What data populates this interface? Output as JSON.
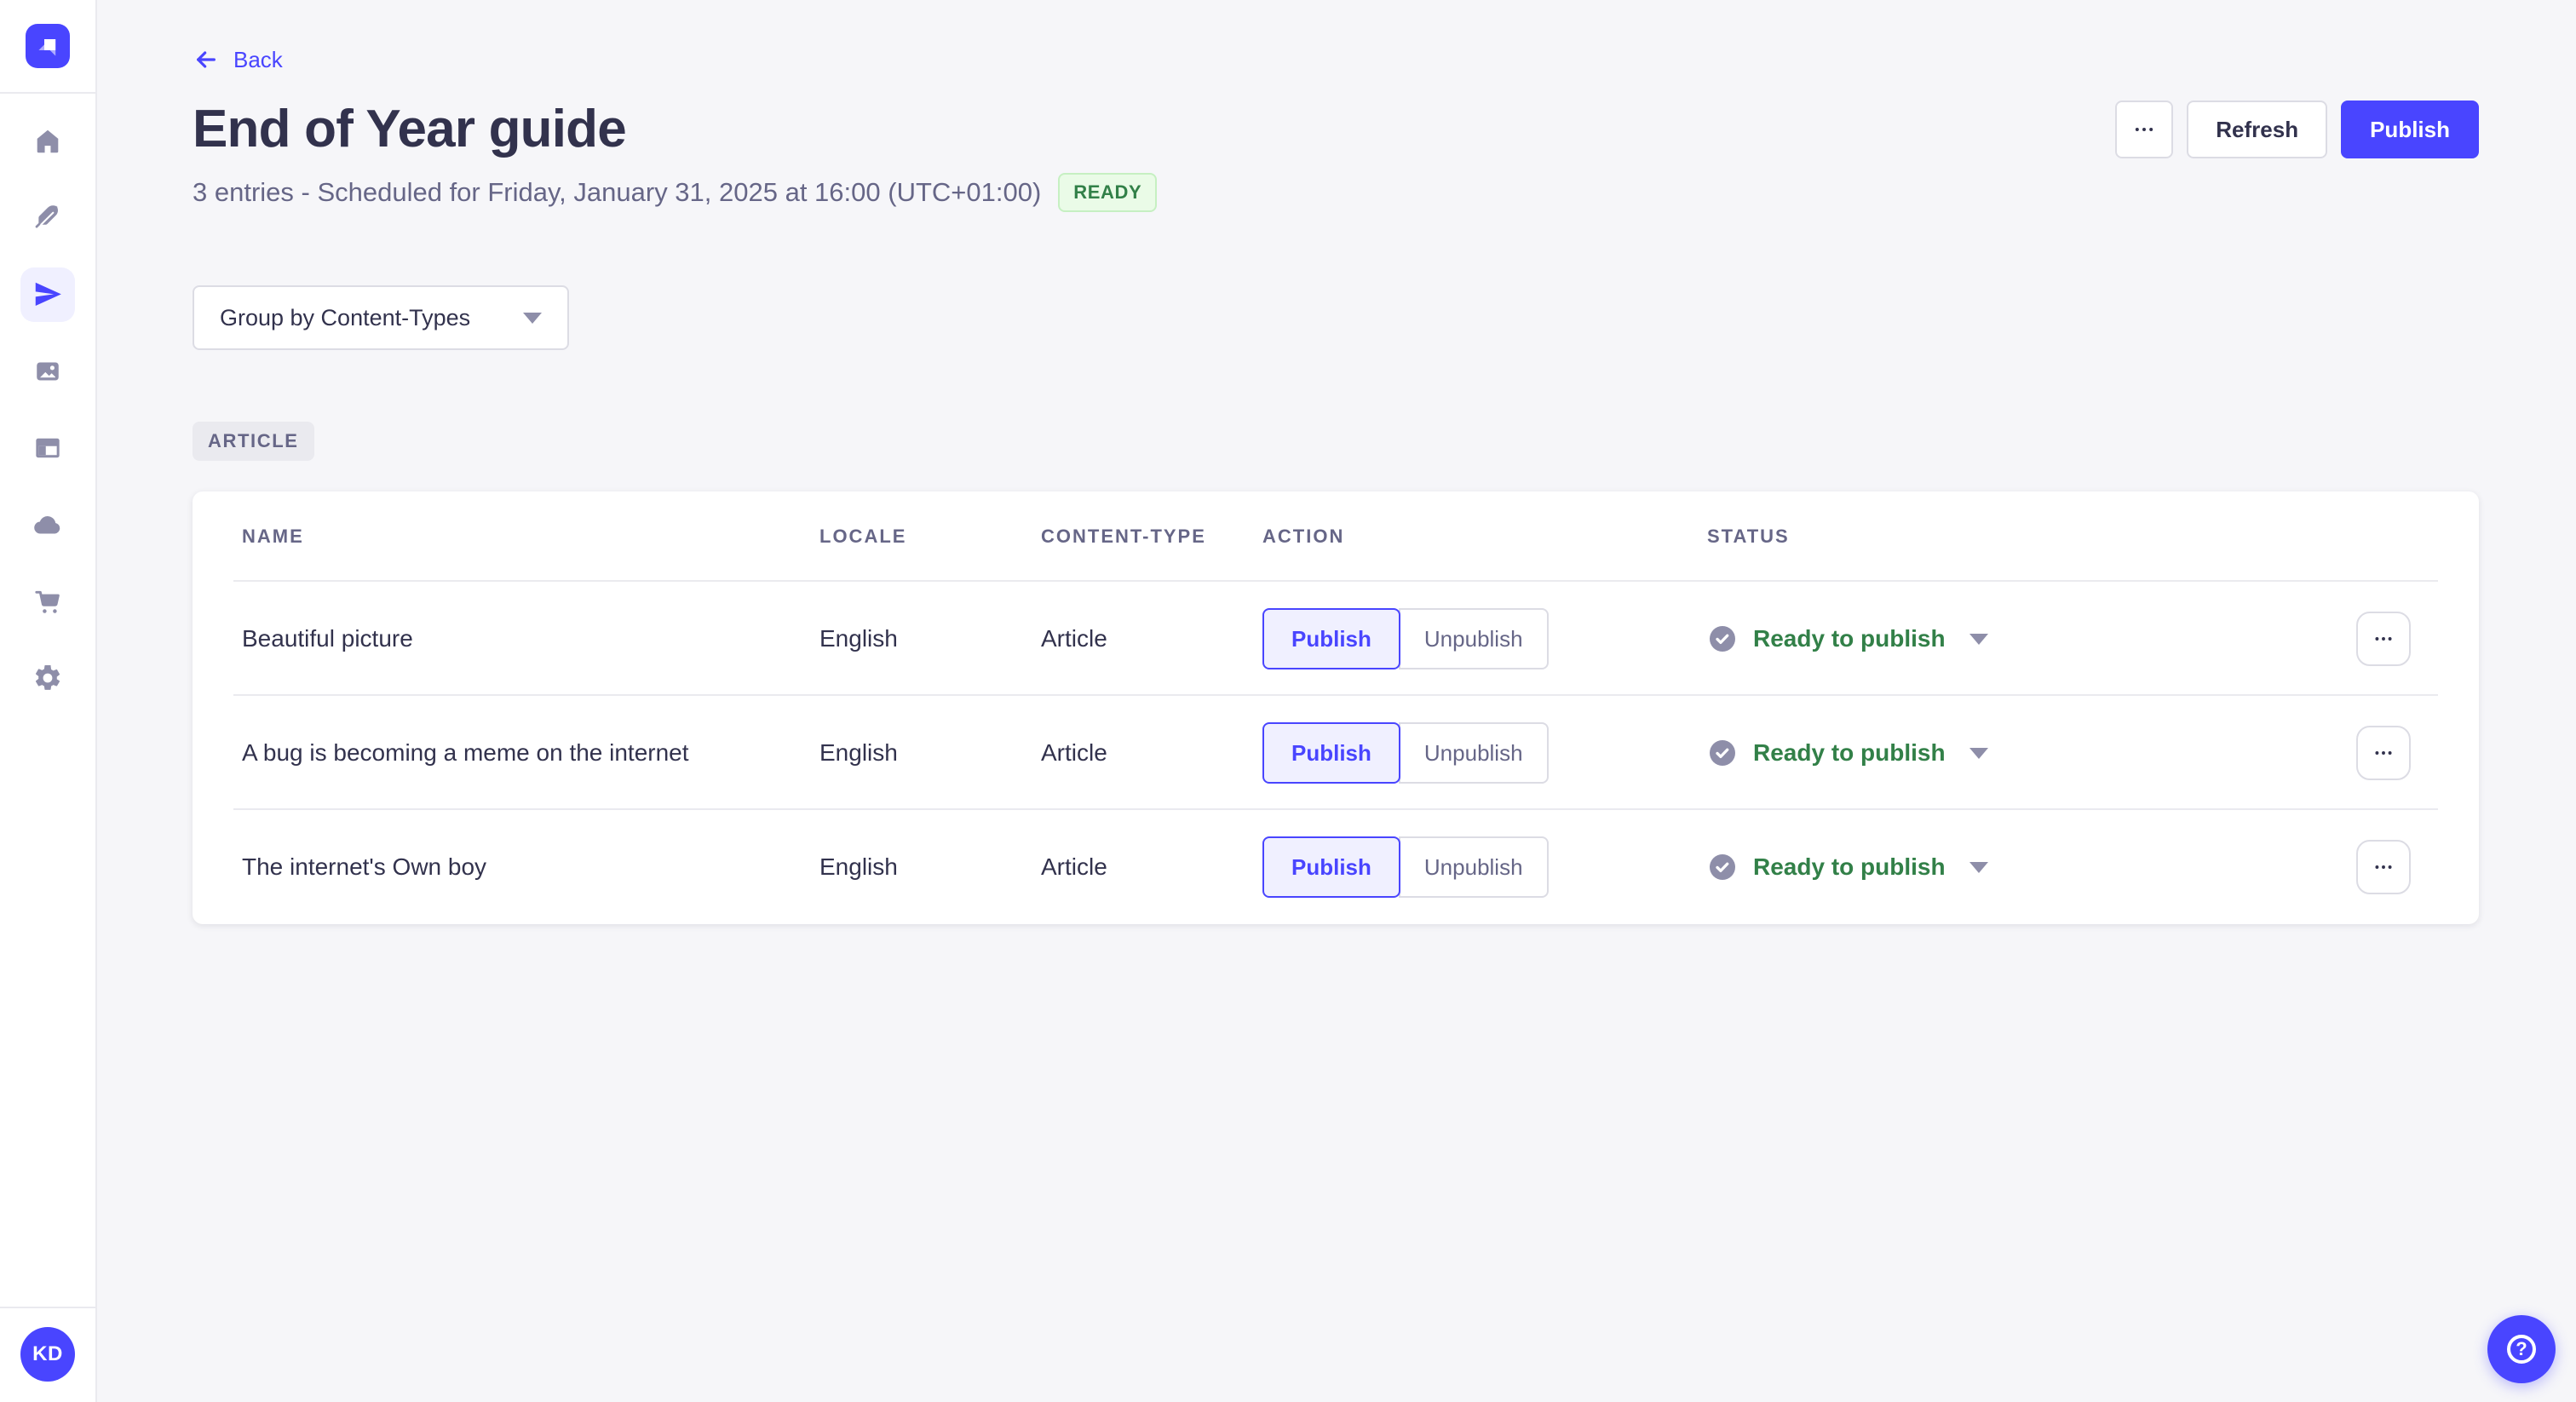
{
  "colors": {
    "primary": "#4945ff",
    "primary_light_bg": "#f0f0ff",
    "success_text": "#328048",
    "success_bg": "#eafbe7",
    "success_border": "#c6f0c2",
    "neutral_icon": "#8e8ea9",
    "text_dark": "#32324d",
    "text_muted": "#666687",
    "border": "#dcdce4",
    "divider": "#eaeaef",
    "page_bg": "#f6f6f9"
  },
  "sidebar": {
    "logo_icon": "strapi-logo-icon",
    "nav_icons": [
      "home-icon",
      "feather-icon",
      "paper-plane-icon",
      "media-library-icon",
      "layout-icon",
      "cloud-icon",
      "cart-icon",
      "gear-icon"
    ],
    "active_nav": "paper-plane-icon",
    "avatar_initials": "KD"
  },
  "header": {
    "back_label": "Back",
    "title": "End of Year guide",
    "subtitle": "3 entries - Scheduled for Friday, January 31, 2025 at 16:00 (UTC+01:00)",
    "ready_badge": "READY",
    "refresh_label": "Refresh",
    "publish_label": "Publish",
    "more_icon": "more-horizontal-icon"
  },
  "toolbar": {
    "group_by_label": "Group by Content-Types"
  },
  "group_badge": "ARTICLE",
  "table": {
    "columns": [
      "NAME",
      "LOCALE",
      "CONTENT-TYPE",
      "ACTION",
      "STATUS"
    ],
    "actions": {
      "publish": "Publish",
      "unpublish": "Unpublish"
    },
    "rows": [
      {
        "name": "Beautiful picture",
        "locale": "English",
        "content_type": "Article",
        "status": "Ready to publish"
      },
      {
        "name": "A bug is becoming a meme on the internet",
        "locale": "English",
        "content_type": "Article",
        "status": "Ready to publish"
      },
      {
        "name": "The internet's Own boy",
        "locale": "English",
        "content_type": "Article",
        "status": "Ready to publish"
      }
    ]
  },
  "help": {
    "icon": "question-mark-icon"
  }
}
